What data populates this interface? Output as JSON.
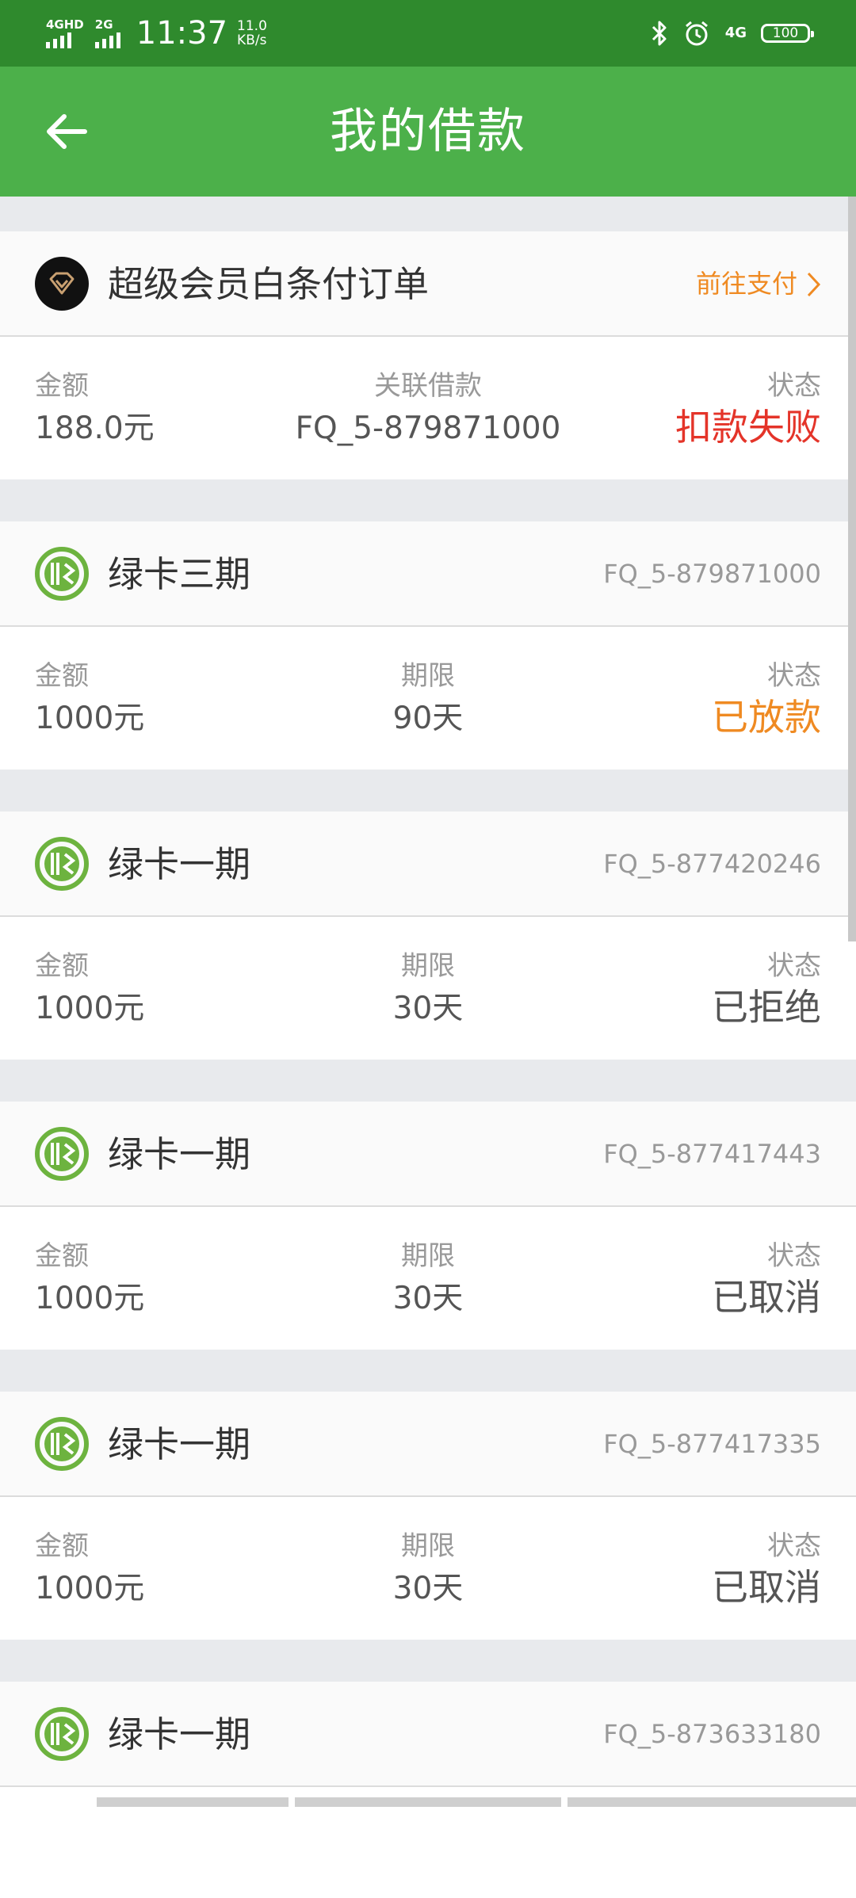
{
  "status_bar": {
    "sig1_label": "4GHD",
    "sig2_label": "2G",
    "time": "11:37",
    "speed_value": "11.0",
    "speed_unit": "KB/s",
    "net_label": "4G",
    "battery": "100"
  },
  "app_bar": {
    "title": "我的借款"
  },
  "super_card": {
    "title": "超级会员白条付订单",
    "action": "前往支付",
    "amount_label": "金额",
    "amount": "188.0元",
    "loan_label": "关联借款",
    "loan": "FQ_5-879871000",
    "status_label": "状态",
    "status": "扣款失败"
  },
  "loans": [
    {
      "title": "绿卡三期",
      "id": "FQ_5-879871000",
      "amount_label": "金额",
      "amount": "1000元",
      "term_label": "期限",
      "term": "90天",
      "status_label": "状态",
      "status": "已放款"
    },
    {
      "title": "绿卡一期",
      "id": "FQ_5-877420246",
      "amount_label": "金额",
      "amount": "1000元",
      "term_label": "期限",
      "term": "30天",
      "status_label": "状态",
      "status": "已拒绝"
    },
    {
      "title": "绿卡一期",
      "id": "FQ_5-877417443",
      "amount_label": "金额",
      "amount": "1000元",
      "term_label": "期限",
      "term": "30天",
      "status_label": "状态",
      "status": "已取消"
    },
    {
      "title": "绿卡一期",
      "id": "FQ_5-877417335",
      "amount_label": "金额",
      "amount": "1000元",
      "term_label": "期限",
      "term": "30天",
      "status_label": "状态",
      "status": "已取消"
    },
    {
      "title": "绿卡一期",
      "id": "FQ_5-873633180"
    }
  ],
  "colors": {
    "status_bar": "#2f8a2d",
    "app_bar": "#4cb04a",
    "brand_green": "#6db33f",
    "accent_orange": "#ef8a22",
    "error_red": "#e43429"
  },
  "icons": {
    "back": "arrow-left-icon",
    "super_logo": "diamond-icon",
    "loan_logo": "green-card-logo-icon",
    "chevron": "chevron-right-icon"
  }
}
